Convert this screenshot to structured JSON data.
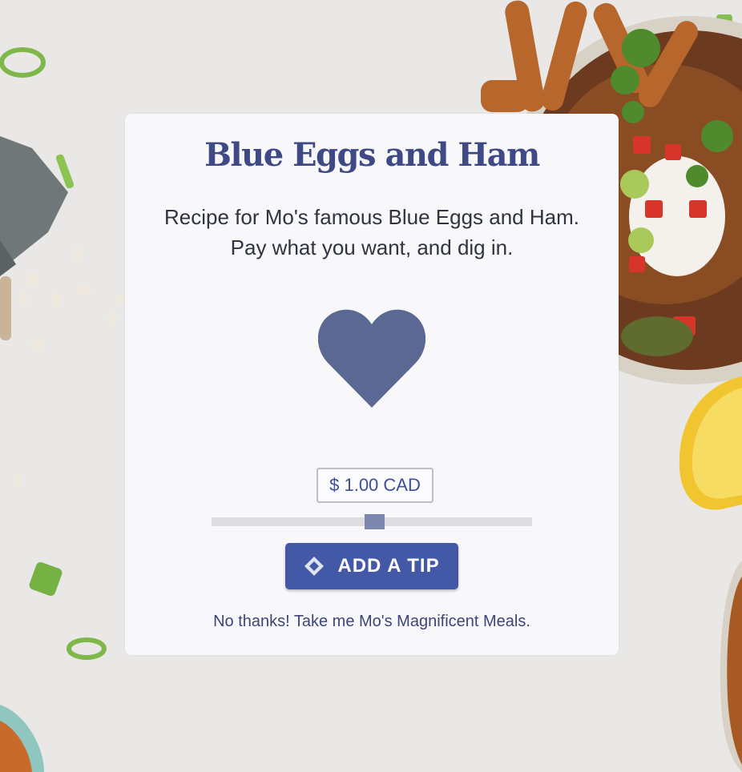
{
  "card": {
    "title": "Blue Eggs and Ham",
    "description": "Recipe for Mo's famous Blue Eggs and Ham. Pay what you want, and dig in.",
    "heart_icon": "heart-icon",
    "amount": "$ 1.00 CAD",
    "slider_level": 0.51,
    "tip_button_label": "ADD A TIP",
    "tip_button_icon": "ko-fi-icon",
    "no_thanks_link": "No thanks! Take me Mo's Magnificent Meals."
  },
  "colors": {
    "title": "#3f4a84",
    "accent": "#4359a8",
    "heart": "#5b6894",
    "slider_thumb": "#7c86ae",
    "card_bg": "#f8f8fb"
  }
}
